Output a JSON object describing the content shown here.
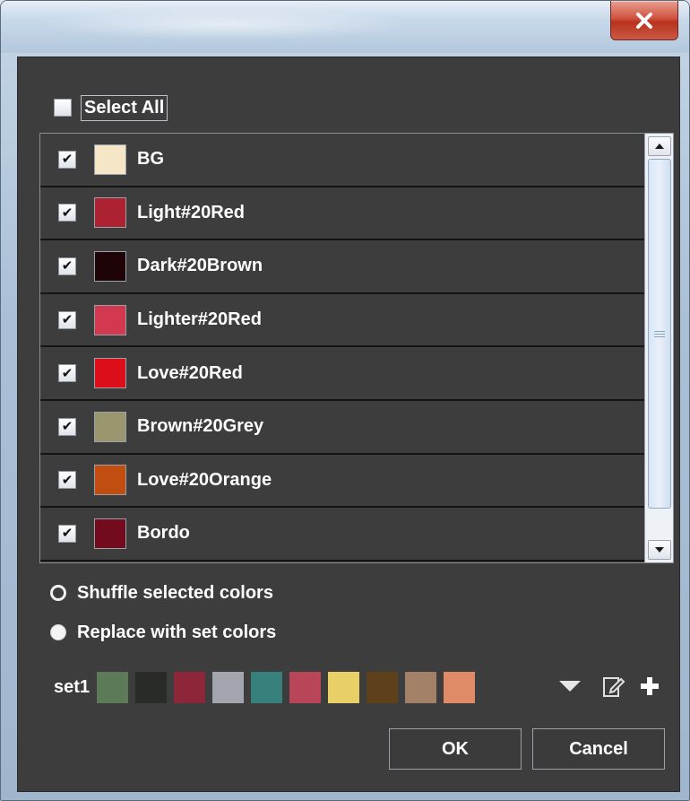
{
  "window": {
    "close_icon": "close-icon"
  },
  "select_all": {
    "label": "Select All",
    "checked": false
  },
  "colors": [
    {
      "name": "BG",
      "color": "#f4e6c6",
      "checked": true
    },
    {
      "name": "Light#20Red",
      "color": "#ac2232",
      "checked": true
    },
    {
      "name": "Dark#20Brown",
      "color": "#1f0407",
      "checked": true
    },
    {
      "name": "Lighter#20Red",
      "color": "#d2384f",
      "checked": true
    },
    {
      "name": "Love#20Red",
      "color": "#dc0e1a",
      "checked": true
    },
    {
      "name": "Brown#20Grey",
      "color": "#9a9670",
      "checked": true
    },
    {
      "name": "Love#20Orange",
      "color": "#c14e10",
      "checked": true
    },
    {
      "name": "Bordo",
      "color": "#720b1e",
      "checked": true
    }
  ],
  "options": {
    "shuffle_label": "Shuffle selected colors",
    "replace_label": "Replace with set colors",
    "selected": "replace"
  },
  "color_set": {
    "name": "set1",
    "swatches": [
      "#5c7a58",
      "#282b28",
      "#8c2638",
      "#a3a5ae",
      "#37807c",
      "#b84558",
      "#e8d066",
      "#5e401a",
      "#a28168",
      "#e18a68"
    ]
  },
  "buttons": {
    "ok": "OK",
    "cancel": "Cancel"
  }
}
